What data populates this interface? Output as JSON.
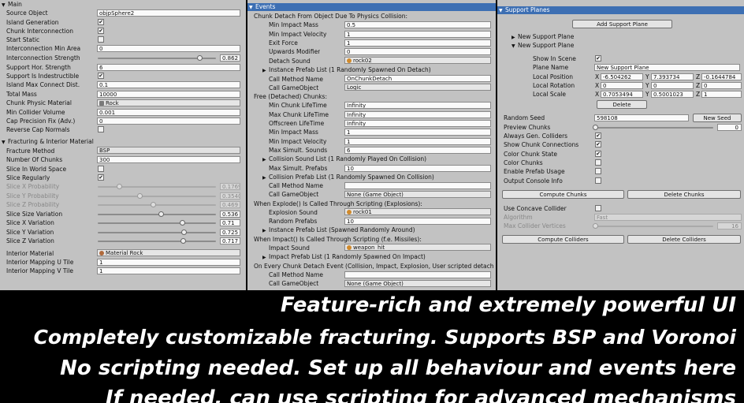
{
  "panel1": {
    "main_header": "Main",
    "source_object_label": "Source Object",
    "source_object_value": "objpSphere2",
    "island_generation_label": "Island Generation",
    "chunk_interconnection_label": "Chunk Interconnection",
    "start_static_label": "Start Static",
    "interconnection_min_area_label": "Interconnection Min Area",
    "interconnection_min_area_value": "0",
    "interconnection_strength_label": "Interconnection Strength",
    "interconnection_strength_value": "0.862",
    "support_hor_strength_label": "Support Hor. Strength",
    "support_hor_strength_value": "6",
    "support_indestructible_label": "Support Is Indestructible",
    "island_max_connect_label": "Island Max Connect Dist.",
    "island_max_connect_value": "0.1",
    "total_mass_label": "Total Mass",
    "total_mass_value": "10000",
    "chunk_physic_material_label": "Chunk Physic Material",
    "chunk_physic_material_value": "Rock",
    "min_collider_volume_label": "Min Collider Volume",
    "min_collider_volume_value": "0.001",
    "cap_precision_label": "Cap Precision Fix (Adv.)",
    "cap_precision_value": "0",
    "reverse_cap_normals_label": "Reverse Cap Normals",
    "fracturing_header": "Fracturing & Interior Material",
    "fracture_method_label": "Fracture Method",
    "fracture_method_value": "BSP",
    "number_of_chunks_label": "Number Of Chunks",
    "number_of_chunks_value": "300",
    "slice_in_world_space_label": "Slice In World Space",
    "slice_regularly_label": "Slice Regularly",
    "slice_x_probability_label": "Slice X Probability",
    "slice_x_probability_value": "0.17694",
    "slice_y_probability_label": "Slice Y Probability",
    "slice_y_probability_value": "0.35405",
    "slice_z_probability_label": "Slice Z Probability",
    "slice_z_probability_value": "0.469",
    "slice_size_variation_label": "Slice Size Variation",
    "slice_size_variation_value": "0.536",
    "slice_x_variation_label": "Slice X Variation",
    "slice_x_variation_value": "0.71",
    "slice_y_variation_label": "Slice Y Variation",
    "slice_y_variation_value": "0.725",
    "slice_z_variation_label": "Slice Z Variation",
    "slice_z_variation_value": "0.717",
    "interior_material_label": "Interior Material",
    "interior_material_value": "Material Rock",
    "interior_mapping_u_label": "Interior Mapping U Tile",
    "interior_mapping_u_value": "1",
    "interior_mapping_v_label": "Interior Mapping V Tile",
    "interior_mapping_v_value": "1"
  },
  "panel2": {
    "events_header": "Events",
    "chunk_detach_header": "Chunk Detach From Object Due To Physics Collision:",
    "min_impact_mass_label": "Min Impact Mass",
    "min_impact_mass_value": "0.5",
    "min_impact_velocity_label": "Min Impact Velocity",
    "min_impact_velocity_value": "1",
    "exit_force_label": "Exit Force",
    "exit_force_value": "1",
    "upwards_modifier_label": "Upwards Modifier",
    "upwards_modifier_value": "0",
    "detach_sound_label": "Detach Sound",
    "detach_sound_value": "rock02",
    "instance_prefab_detach_label": "Instance Prefab List (1 Randomly Spawned On Detach)",
    "call_method_name_label": "Call Method Name",
    "call_method_name_value": "OnChunkDetach",
    "call_gameobject_label": "Call GameObject",
    "call_gameobject_value": "Logic",
    "free_chunks_header": "Free (Detached) Chunks:",
    "min_chunk_lifetime_label": "Min Chunk LifeTime",
    "min_chunk_lifetime_value": "Infinity",
    "max_chunk_lifetime_label": "Max Chunk LifeTime",
    "max_chunk_lifetime_value": "Infinity",
    "offscreen_lifetime_label": "Offscreen LifeTime",
    "offscreen_lifetime_value": "Infinity",
    "free_min_impact_mass_label": "Min Impact Mass",
    "free_min_impact_mass_value": "1",
    "free_min_impact_velocity_label": "Min Impact Velocity",
    "free_min_impact_velocity_value": "1",
    "max_simult_sounds_label": "Max Simult. Sounds",
    "max_simult_sounds_value": "6",
    "collision_sound_list_label": "Collision Sound List (1 Randomly Played On Collision)",
    "max_simult_prefabs_label": "Max Simult. Prefabs",
    "max_simult_prefabs_value": "10",
    "collision_prefab_list_label": "Collision Prefab List (1 Randomly Spawned On Collision)",
    "free_call_method_name_label": "Call Method Name",
    "free_call_method_name_value": "",
    "free_call_gameobject_label": "Call GameObject",
    "free_call_gameobject_value": "None (Game Object)",
    "explode_header": "When Explode() Is Called Through Scripting (Explosions):",
    "explosion_sound_label": "Explosion Sound",
    "explosion_sound_value": "rock01",
    "random_prefabs_label": "Random Prefabs",
    "random_prefabs_value": "10",
    "instance_prefab_explode_label": "Instance Prefab List (Spawned Randomly Around)",
    "impact_header": "When Impact() Is Called Through Scripting (f.e. Missiles):",
    "impact_sound_label": "Impact Sound",
    "impact_sound_value": "weapon_hit",
    "impact_prefab_list_label": "Impact Prefab List (1 Randomly Spawned On Impact)",
    "every_chunk_header": "On Every Chunk Detach Event (Collision, Impact, Explosion, User scripted detach...)",
    "every_call_method_name_label": "Call Method Name",
    "every_call_method_name_value": "",
    "every_call_gameobject_label": "Call GameObject",
    "every_call_gameobject_value": "None (Game Object)"
  },
  "panel3": {
    "support_planes_header": "Support Planes",
    "add_support_plane_button": "Add Support Plane",
    "new_support_plane_1": "New Support Plane",
    "new_support_plane_2": "New Support Plane",
    "show_in_scene_label": "Show In Scene",
    "plane_name_label": "Plane Name",
    "plane_name_value": "New Support Plane",
    "local_position_label": "Local Position",
    "local_position_x": "-6.504262",
    "local_position_y": "7.393734",
    "local_position_z": "-0.1644784",
    "local_rotation_label": "Local Rotation",
    "local_rotation_x": "0",
    "local_rotation_y": "0",
    "local_rotation_z": "0",
    "local_scale_label": "Local Scale",
    "local_scale_x": "0.7053494",
    "local_scale_y": "0.5001023",
    "local_scale_z": "1",
    "axis_x": "X",
    "axis_y": "Y",
    "axis_z": "Z",
    "delete_button": "Delete",
    "random_seed_label": "Random Seed",
    "random_seed_value": "598108",
    "new_seed_button": "New Seed",
    "preview_chunks_label": "Preview Chunks",
    "preview_chunks_value": "0",
    "always_gen_colliders_label": "Always Gen. Colliders",
    "show_chunk_connections_label": "Show Chunk Connections",
    "color_chunk_state_label": "Color Chunk State",
    "color_chunks_label": "Color Chunks",
    "enable_prefab_usage_label": "Enable Prefab Usage",
    "output_console_info_label": "Output Console Info",
    "compute_chunks_button": "Compute Chunks",
    "delete_chunks_button": "Delete Chunks",
    "use_concave_collider_label": "Use Concave Collider",
    "algorithm_label": "Algorithm",
    "algorithm_value": "Fast",
    "max_collider_vertices_label": "Max Collider Vertices",
    "max_collider_vertices_value": "16",
    "compute_colliders_button": "Compute Colliders",
    "delete_colliders_button": "Delete Colliders"
  },
  "banner": {
    "line1": "Feature-rich and extremely powerful UI",
    "line2": "Completely customizable fracturing. Supports BSP and Voronoi",
    "line3": "No scripting needed. Set up all behaviour and events here",
    "line4": "If needed, can use scripting for advanced mechanisms"
  },
  "colors": {
    "panel_bg": "#c2c2c2",
    "selected_header": "#3d6fb3",
    "banner_bg": "#000000",
    "banner_text": "#ffffff"
  },
  "icons": {
    "audio": "audio-clip-icon",
    "material": "material-icon",
    "foldout": "triangle-foldout-icon",
    "checkmark": "checkmark-icon"
  },
  "state": {
    "island_generation": true,
    "chunk_interconnection": true,
    "start_static": false,
    "support_indestructible": true,
    "reverse_cap_normals": false,
    "slice_in_world_space": false,
    "slice_regularly": true,
    "show_in_scene": true,
    "always_gen_colliders": true,
    "show_chunk_connections": true,
    "color_chunk_state": true,
    "color_chunks": false,
    "enable_prefab_usage": false,
    "output_console_info": false,
    "use_concave_collider": false,
    "interconnection_strength": 0.862,
    "slice_x_probability": 0.17694,
    "slice_y_probability": 0.35405,
    "slice_z_probability": 0.469,
    "slice_size_variation": 0.536,
    "slice_x_variation": 0.71,
    "slice_y_variation": 0.725,
    "slice_z_variation": 0.717,
    "preview_chunks": 0,
    "max_collider_vertices_fraction": 0
  }
}
